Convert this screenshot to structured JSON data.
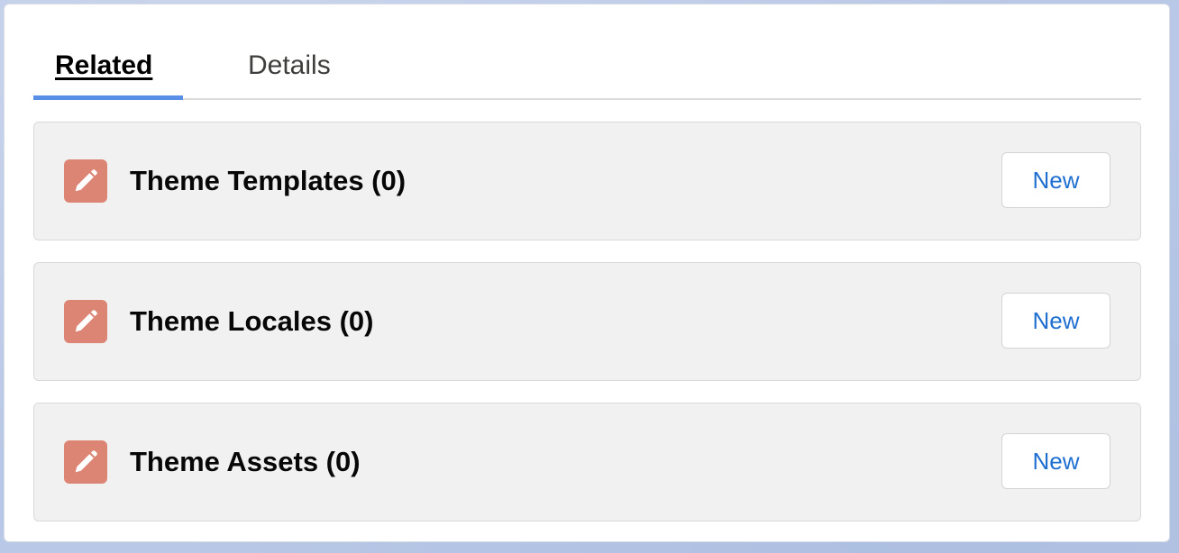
{
  "tabs": [
    {
      "label": "Related",
      "active": true
    },
    {
      "label": "Details",
      "active": false
    }
  ],
  "sections": [
    {
      "title": "Theme Templates (0)",
      "button_label": "New",
      "icon": "pencil-icon"
    },
    {
      "title": "Theme Locales (0)",
      "button_label": "New",
      "icon": "pencil-icon"
    },
    {
      "title": "Theme Assets (0)",
      "button_label": "New",
      "icon": "pencil-icon"
    }
  ],
  "colors": {
    "active_tab_indicator": "#5a8fe8",
    "icon_background": "#dd8574",
    "button_text": "#1f6fd1",
    "section_background": "#f1f1f1"
  }
}
